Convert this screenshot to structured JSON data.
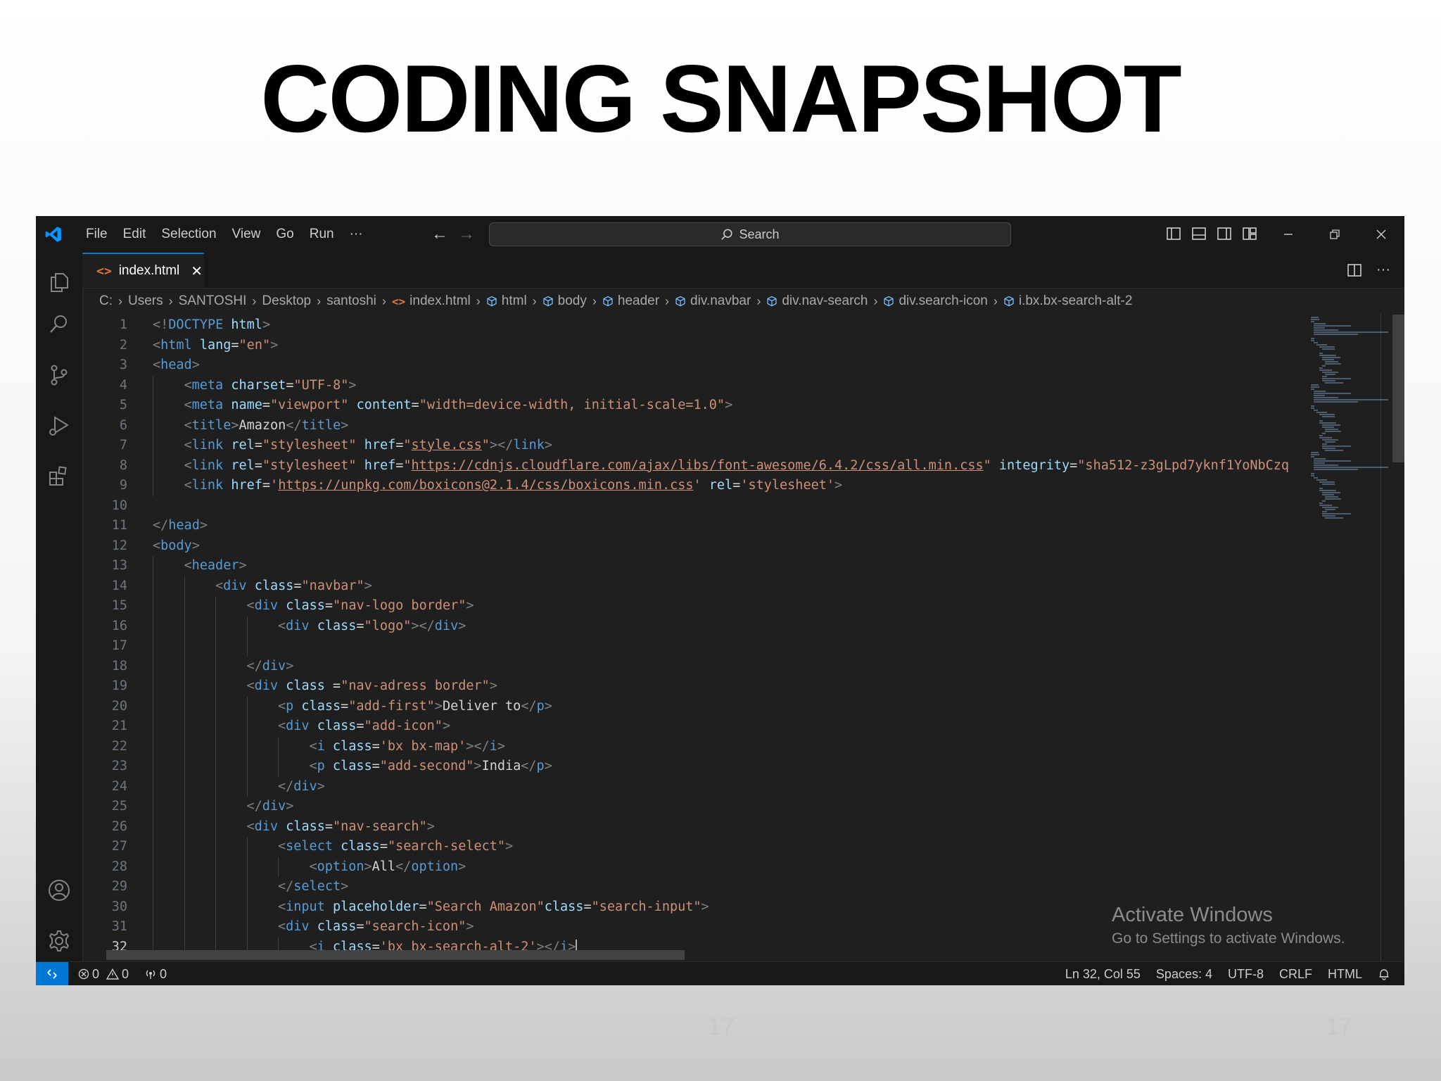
{
  "slide": {
    "title": "CODING SNAPSHOT",
    "page_number": "17",
    "page_number_2": "17"
  },
  "menu": [
    "File",
    "Edit",
    "Selection",
    "View",
    "Go",
    "Run",
    "···"
  ],
  "search": {
    "label": "Search"
  },
  "tab": {
    "filename": "index.html",
    "icon": "<>",
    "close": "✕"
  },
  "breadcrumb": [
    {
      "label": "C:",
      "icon": ""
    },
    {
      "label": "Users",
      "icon": ""
    },
    {
      "label": "SANTOSHI",
      "icon": ""
    },
    {
      "label": "Desktop",
      "icon": ""
    },
    {
      "label": "santoshi",
      "icon": ""
    },
    {
      "label": "index.html",
      "icon": "html"
    },
    {
      "label": "html",
      "icon": "cube"
    },
    {
      "label": "body",
      "icon": "cube"
    },
    {
      "label": "header",
      "icon": "cube"
    },
    {
      "label": "div.navbar",
      "icon": "cube"
    },
    {
      "label": "div.nav-search",
      "icon": "cube"
    },
    {
      "label": "div.search-icon",
      "icon": "cube"
    },
    {
      "label": "i.bx.bx-search-alt-2",
      "icon": "cube"
    }
  ],
  "editor": {
    "active_line": 32,
    "lines": [
      {
        "n": "1",
        "indent": 0,
        "tokens": [
          [
            "t",
            "<!"
          ],
          [
            "tg",
            "DOCTYPE"
          ],
          [
            "x",
            " "
          ],
          [
            "a",
            "html"
          ],
          [
            "t",
            ">"
          ]
        ]
      },
      {
        "n": "2",
        "indent": 0,
        "tokens": [
          [
            "t",
            "<"
          ],
          [
            "tg",
            "html"
          ],
          [
            "x",
            " "
          ],
          [
            "a",
            "lang"
          ],
          [
            "x",
            "="
          ],
          [
            "s",
            "\"en\""
          ],
          [
            "t",
            ">"
          ]
        ]
      },
      {
        "n": "3",
        "indent": 0,
        "tokens": [
          [
            "t",
            "<"
          ],
          [
            "tg",
            "head"
          ],
          [
            "t",
            ">"
          ]
        ]
      },
      {
        "n": "4",
        "indent": 1,
        "tokens": [
          [
            "t",
            "<"
          ],
          [
            "tg",
            "meta"
          ],
          [
            "x",
            " "
          ],
          [
            "a",
            "charset"
          ],
          [
            "x",
            "="
          ],
          [
            "s",
            "\"UTF-8\""
          ],
          [
            "t",
            ">"
          ]
        ]
      },
      {
        "n": "5",
        "indent": 1,
        "tokens": [
          [
            "t",
            "<"
          ],
          [
            "tg",
            "meta"
          ],
          [
            "x",
            " "
          ],
          [
            "a",
            "name"
          ],
          [
            "x",
            "="
          ],
          [
            "s",
            "\"viewport\""
          ],
          [
            "x",
            " "
          ],
          [
            "a",
            "content"
          ],
          [
            "x",
            "="
          ],
          [
            "s",
            "\"width=device-width, initial-scale=1.0\""
          ],
          [
            "t",
            ">"
          ]
        ]
      },
      {
        "n": "6",
        "indent": 1,
        "tokens": [
          [
            "t",
            "<"
          ],
          [
            "tg",
            "title"
          ],
          [
            "t",
            ">"
          ],
          [
            "x",
            "Amazon"
          ],
          [
            "t",
            "</"
          ],
          [
            "tg",
            "title"
          ],
          [
            "t",
            ">"
          ]
        ]
      },
      {
        "n": "7",
        "indent": 1,
        "tokens": [
          [
            "t",
            "<"
          ],
          [
            "tg",
            "link"
          ],
          [
            "x",
            " "
          ],
          [
            "a",
            "rel"
          ],
          [
            "x",
            "="
          ],
          [
            "s",
            "\"stylesheet\""
          ],
          [
            "x",
            " "
          ],
          [
            "a",
            "href"
          ],
          [
            "x",
            "="
          ],
          [
            "s",
            "\""
          ],
          [
            "su",
            "style.css"
          ],
          [
            "s",
            "\""
          ],
          [
            "t",
            "></"
          ],
          [
            "tg",
            "link"
          ],
          [
            "t",
            ">"
          ]
        ]
      },
      {
        "n": "8",
        "indent": 1,
        "tokens": [
          [
            "t",
            "<"
          ],
          [
            "tg",
            "link"
          ],
          [
            "x",
            " "
          ],
          [
            "a",
            "rel"
          ],
          [
            "x",
            "="
          ],
          [
            "s",
            "\"stylesheet\""
          ],
          [
            "x",
            " "
          ],
          [
            "a",
            "href"
          ],
          [
            "x",
            "="
          ],
          [
            "s",
            "\""
          ],
          [
            "su",
            "https://cdnjs.cloudflare.com/ajax/libs/font-awesome/6.4.2/css/all.min.css"
          ],
          [
            "s",
            "\""
          ],
          [
            "x",
            " "
          ],
          [
            "a",
            "integrity"
          ],
          [
            "x",
            "="
          ],
          [
            "s",
            "\"sha512-z3gLpd7yknf1YoNbCzq"
          ]
        ]
      },
      {
        "n": "9",
        "indent": 1,
        "tokens": [
          [
            "t",
            "<"
          ],
          [
            "tg",
            "link"
          ],
          [
            "x",
            " "
          ],
          [
            "a",
            "href"
          ],
          [
            "x",
            "="
          ],
          [
            "s",
            "'"
          ],
          [
            "su",
            "https://unpkg.com/boxicons@2.1.4/css/boxicons.min.css"
          ],
          [
            "s",
            "'"
          ],
          [
            "x",
            " "
          ],
          [
            "a",
            "rel"
          ],
          [
            "x",
            "="
          ],
          [
            "s",
            "'stylesheet'"
          ],
          [
            "t",
            ">"
          ]
        ]
      },
      {
        "n": "10",
        "indent": 0,
        "tokens": []
      },
      {
        "n": "11",
        "indent": 0,
        "tokens": [
          [
            "t",
            "</"
          ],
          [
            "tg",
            "head"
          ],
          [
            "t",
            ">"
          ]
        ]
      },
      {
        "n": "12",
        "indent": 0,
        "tokens": [
          [
            "t",
            "<"
          ],
          [
            "tg",
            "body"
          ],
          [
            "t",
            ">"
          ]
        ]
      },
      {
        "n": "13",
        "indent": 1,
        "tokens": [
          [
            "t",
            "<"
          ],
          [
            "tg",
            "header"
          ],
          [
            "t",
            ">"
          ]
        ]
      },
      {
        "n": "14",
        "indent": 2,
        "tokens": [
          [
            "t",
            "<"
          ],
          [
            "tg",
            "div"
          ],
          [
            "x",
            " "
          ],
          [
            "a",
            "class"
          ],
          [
            "x",
            "="
          ],
          [
            "s",
            "\"navbar\""
          ],
          [
            "t",
            ">"
          ]
        ]
      },
      {
        "n": "15",
        "indent": 3,
        "tokens": [
          [
            "t",
            "<"
          ],
          [
            "tg",
            "div"
          ],
          [
            "x",
            " "
          ],
          [
            "a",
            "class"
          ],
          [
            "x",
            "="
          ],
          [
            "s",
            "\"nav-logo border\""
          ],
          [
            "t",
            ">"
          ]
        ]
      },
      {
        "n": "16",
        "indent": 4,
        "tokens": [
          [
            "t",
            "<"
          ],
          [
            "tg",
            "div"
          ],
          [
            "x",
            " "
          ],
          [
            "a",
            "class"
          ],
          [
            "x",
            "="
          ],
          [
            "s",
            "\"logo\""
          ],
          [
            "t",
            "></"
          ],
          [
            "tg",
            "div"
          ],
          [
            "t",
            ">"
          ]
        ]
      },
      {
        "n": "17",
        "indent": 4,
        "tokens": []
      },
      {
        "n": "18",
        "indent": 3,
        "tokens": [
          [
            "t",
            "</"
          ],
          [
            "tg",
            "div"
          ],
          [
            "t",
            ">"
          ]
        ]
      },
      {
        "n": "19",
        "indent": 3,
        "tokens": [
          [
            "t",
            "<"
          ],
          [
            "tg",
            "div"
          ],
          [
            "x",
            " "
          ],
          [
            "a",
            "class"
          ],
          [
            "x",
            " ="
          ],
          [
            "s",
            "\"nav-adress border\""
          ],
          [
            "t",
            ">"
          ]
        ]
      },
      {
        "n": "20",
        "indent": 4,
        "tokens": [
          [
            "t",
            "<"
          ],
          [
            "tg",
            "p"
          ],
          [
            "x",
            " "
          ],
          [
            "a",
            "class"
          ],
          [
            "x",
            "="
          ],
          [
            "s",
            "\"add-first\""
          ],
          [
            "t",
            ">"
          ],
          [
            "x",
            "Deliver to"
          ],
          [
            "t",
            "</"
          ],
          [
            "tg",
            "p"
          ],
          [
            "t",
            ">"
          ]
        ]
      },
      {
        "n": "21",
        "indent": 4,
        "tokens": [
          [
            "t",
            "<"
          ],
          [
            "tg",
            "div"
          ],
          [
            "x",
            " "
          ],
          [
            "a",
            "class"
          ],
          [
            "x",
            "="
          ],
          [
            "s",
            "\"add-icon\""
          ],
          [
            "t",
            ">"
          ]
        ]
      },
      {
        "n": "22",
        "indent": 5,
        "tokens": [
          [
            "t",
            "<"
          ],
          [
            "tg",
            "i"
          ],
          [
            "x",
            " "
          ],
          [
            "a",
            "class"
          ],
          [
            "x",
            "="
          ],
          [
            "s",
            "'bx bx-map'"
          ],
          [
            "t",
            "></"
          ],
          [
            "tg",
            "i"
          ],
          [
            "t",
            ">"
          ]
        ]
      },
      {
        "n": "23",
        "indent": 5,
        "tokens": [
          [
            "t",
            "<"
          ],
          [
            "tg",
            "p"
          ],
          [
            "x",
            " "
          ],
          [
            "a",
            "class"
          ],
          [
            "x",
            "="
          ],
          [
            "s",
            "\"add-second\""
          ],
          [
            "t",
            ">"
          ],
          [
            "x",
            "India"
          ],
          [
            "t",
            "</"
          ],
          [
            "tg",
            "p"
          ],
          [
            "t",
            ">"
          ]
        ]
      },
      {
        "n": "24",
        "indent": 4,
        "tokens": [
          [
            "t",
            "</"
          ],
          [
            "tg",
            "div"
          ],
          [
            "t",
            ">"
          ]
        ]
      },
      {
        "n": "25",
        "indent": 3,
        "tokens": [
          [
            "t",
            "</"
          ],
          [
            "tg",
            "div"
          ],
          [
            "t",
            ">"
          ]
        ]
      },
      {
        "n": "26",
        "indent": 3,
        "tokens": [
          [
            "t",
            "<"
          ],
          [
            "tg",
            "div"
          ],
          [
            "x",
            " "
          ],
          [
            "a",
            "class"
          ],
          [
            "x",
            "="
          ],
          [
            "s",
            "\"nav-search\""
          ],
          [
            "t",
            ">"
          ]
        ]
      },
      {
        "n": "27",
        "indent": 4,
        "tokens": [
          [
            "t",
            "<"
          ],
          [
            "tg",
            "select"
          ],
          [
            "x",
            " "
          ],
          [
            "a",
            "class"
          ],
          [
            "x",
            "="
          ],
          [
            "s",
            "\"search-select\""
          ],
          [
            "t",
            ">"
          ]
        ]
      },
      {
        "n": "28",
        "indent": 5,
        "tokens": [
          [
            "t",
            "<"
          ],
          [
            "tg",
            "option"
          ],
          [
            "t",
            ">"
          ],
          [
            "x",
            "All"
          ],
          [
            "t",
            "</"
          ],
          [
            "tg",
            "option"
          ],
          [
            "t",
            ">"
          ]
        ]
      },
      {
        "n": "29",
        "indent": 4,
        "tokens": [
          [
            "t",
            "</"
          ],
          [
            "tg",
            "select"
          ],
          [
            "t",
            ">"
          ]
        ]
      },
      {
        "n": "30",
        "indent": 4,
        "tokens": [
          [
            "t",
            "<"
          ],
          [
            "tg",
            "input"
          ],
          [
            "x",
            " "
          ],
          [
            "a",
            "placeholder"
          ],
          [
            "x",
            "="
          ],
          [
            "s",
            "\"Search Amazon\""
          ],
          [
            "a",
            "class"
          ],
          [
            "x",
            "="
          ],
          [
            "s",
            "\"search-input\""
          ],
          [
            "t",
            ">"
          ]
        ]
      },
      {
        "n": "31",
        "indent": 4,
        "tokens": [
          [
            "t",
            "<"
          ],
          [
            "tg",
            "div"
          ],
          [
            "x",
            " "
          ],
          [
            "a",
            "class"
          ],
          [
            "x",
            "="
          ],
          [
            "s",
            "\"search-icon\""
          ],
          [
            "t",
            ">"
          ]
        ]
      },
      {
        "n": "32",
        "indent": 5,
        "tokens": [
          [
            "t",
            "<"
          ],
          [
            "tg",
            "i"
          ],
          [
            "x",
            " "
          ],
          [
            "a",
            "class"
          ],
          [
            "x",
            "="
          ],
          [
            "s",
            "'bx bx-search-alt-2'"
          ],
          [
            "t",
            "></"
          ],
          [
            "tg",
            "i"
          ],
          [
            "t",
            ">"
          ]
        ]
      }
    ]
  },
  "watermark": {
    "title": "Activate Windows",
    "subtitle": "Go to Settings to activate Windows."
  },
  "status": {
    "errors": "0",
    "warnings": "0",
    "ports": "0",
    "position": "Ln 32, Col 55",
    "spaces": "Spaces: 4",
    "encoding": "UTF-8",
    "eol": "CRLF",
    "language": "HTML"
  },
  "colors": {
    "accent": "#0078d4",
    "editor_bg": "#1f1f1f",
    "chrome_bg": "#181818"
  }
}
